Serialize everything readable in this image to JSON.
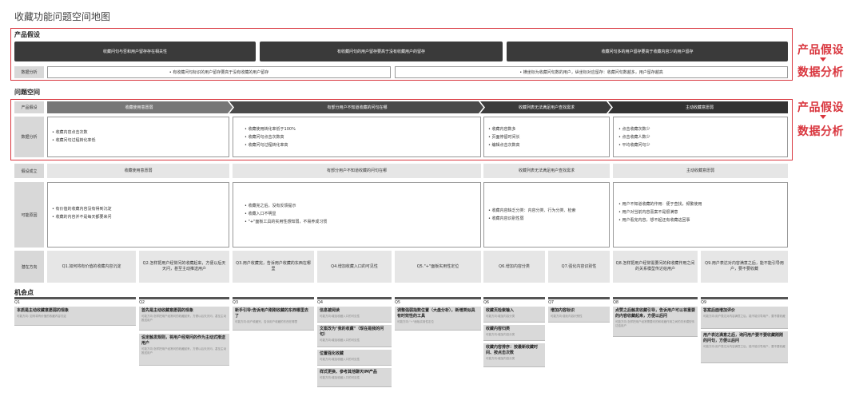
{
  "title": "收藏功能问题空间地图",
  "hypothesis_section": {
    "label": "产品假设",
    "bars": [
      "收藏问句与否和用户留存存在相关性",
      "有收藏问句的用户留存要高于没有收藏用户的留存",
      "收藏问句多的用户留存要高于收藏内容少的用户留存"
    ],
    "analysis_label": "数据分析",
    "analysis_items": [
      "• 有收藏问句标识的用户留存要高于没有收藏的用户留存",
      "• 横坐标为收藏问句数的用户，纵坐标对应留存：收藏问句数越多，用户留存越高"
    ]
  },
  "side_labels": {
    "hypothesis": "产品假设",
    "analysis": "数据分析"
  },
  "problem_space": {
    "label": "问题空间",
    "row_hypothesis": "产品假设",
    "row_analysis": "数据分析",
    "row_valid": "假设成立",
    "row_reasons": "可能原因",
    "row_directions": "潜在方向",
    "columns": [
      {
        "header": "收藏使用意愿弱",
        "analysis": [
          "• 收藏内容点击次数",
          "• 收藏问句过程转化率低"
        ],
        "valid": "收藏使用意愿弱",
        "reasons": [
          "• 有价值的收藏内容没有得到沉淀",
          "• 收藏的内容并不是每天都要来问"
        ],
        "directions": [
          "Q1.如何将有价值的收藏内容沉淀",
          "Q2.怎样把用户经常问的收藏起来，方便以后天天问，甚至主动推送用户"
        ]
      },
      {
        "header": "有部分用户不知道收藏的问句在哪",
        "analysis": [
          "• 收藏使用转化率低于100%",
          "• 收藏问句点击次数高",
          "• 收藏问句过程转化率高"
        ],
        "valid": "有部分用户不知道收藏的问句在哪",
        "reasons": [
          "• 收藏完之后，没有反馈提示",
          "• 收藏入口不明显",
          "• \"+\"面板工具的实用性感知弱，不易养成习惯"
        ],
        "directions": [
          "Q3.用户收藏完，告诉用户收藏的东西在哪里",
          "Q4.增加收藏入口的可见性",
          "Q5.\"+\"面板实用性定位"
        ]
      },
      {
        "header": "收藏列表无法满足用户查找需求",
        "analysis": [
          "• 收藏内容数多",
          "• 页面停留时间长",
          "• 编辑点击次数高"
        ],
        "valid": "收藏列表无法满足用户查找需求",
        "reasons": [
          "• 收藏内容缺乏分类：内容分类、行为分类、检索",
          "• 收藏内容识别性弱"
        ],
        "directions": [
          "Q6.增加内容分类",
          "Q7.强化内容识别性"
        ]
      },
      {
        "header": "主动收藏意愿弱",
        "analysis": [
          "• 点击收藏次数少",
          "• 点击收藏人数少",
          "• 平均收藏问句少"
        ],
        "valid": "主动收藏意愿弱",
        "reasons": [
          "• 用户不知道收藏的作用：便于查找，频繁使用",
          "• 用户对当前内容喜案不是很满意",
          "• 用户看完内容，想不起还有收藏这回事"
        ],
        "directions": [
          "Q8.怎样把用户经常需要问的和收藏作用之间的关系模型传达给用户",
          "Q9.用户表达对内容满意之后，能不能引导用户，要不要收藏"
        ]
      }
    ]
  },
  "opportunities": {
    "label": "机会点",
    "columns": [
      {
        "q": "Q1",
        "cards": [
          {
            "t": "本质是主动收藏意愿弱的现象",
            "s": "可能方向: 如何将有价值的收藏内容沉淀"
          }
        ]
      },
      {
        "q": "Q2",
        "cards": [
          {
            "t": "首先是主动收藏意愿弱的现象",
            "s": "可能方向:怎样把用户经常问的收藏起来，方便以后天天问，甚至主动推送用户"
          },
          {
            "t": "设定触发规则，将用户经常问的作为主动式推送用户",
            "s": "可能方向:怎样把用户经常问的收藏起来，方便以后天天问，甚至主动推送用户"
          }
        ]
      },
      {
        "q": "Q3",
        "cards": [
          {
            "t": "新手引导:告诉用户刚刚收藏的东西哪里去了",
            "s": "可能方向:用户收藏完，告诉用户收藏的东西在哪里"
          }
        ]
      },
      {
        "q": "Q4",
        "cards": [
          {
            "t": "信息被阅读",
            "s": "可能方向:增加收藏入口的可见性"
          },
          {
            "t": "文案改为\"我的收藏\"（现在是我的问句）",
            "s": "可能方向:增加收藏入口的可见性"
          },
          {
            "t": "位置强化收藏",
            "s": "可能方向:增加收藏入口的可见性"
          },
          {
            "t": "样式更换、参考其他聊天IM产品",
            "s": "可能方向:增加收藏入口的可见性"
          }
        ]
      },
      {
        "q": "Q5",
        "cards": [
          {
            "t": "调整强弱指数位置（大盘分析），新增类似具有时效性的工具",
            "s": "可能方向:\"+\"面板实用性定位"
          }
        ]
      },
      {
        "q": "Q6",
        "cards": [
          {
            "t": "收藏页检索输入",
            "s": "可能方向:增加内容分类"
          },
          {
            "t": "收藏内容归类",
            "s": "可能方向:增加内容分类"
          },
          {
            "t": "收藏内容排序：按最新收藏时间、按点击次数",
            "s": "可能方向:增加内容分类"
          }
        ]
      },
      {
        "q": "Q7",
        "cards": [
          {
            "t": "增加内容标识",
            "s": "可能方向:强化内容识别性"
          }
        ]
      },
      {
        "q": "Q8",
        "cards": [
          {
            "t": "点赞之后触发收藏引导，告诉用户可以将重要的内容收藏起来，方便以后问",
            "s": "可能方向:怎样把用户经常需要问的和收藏作用之间的关系模型传达给用户"
          }
        ]
      },
      {
        "q": "Q9",
        "cards": [
          {
            "t": "答案后面增加评价",
            "s": "可能方向:用户表达对内容满意之后，能不能引导用户，要不要收藏"
          },
          {
            "t": "用户表达满意之后，询问用户要不要收藏刚刚的问句，方便以后问",
            "s": "可能方向:用户表达对内容满意之后，能不能引导用户，要不要收藏"
          }
        ]
      }
    ]
  }
}
